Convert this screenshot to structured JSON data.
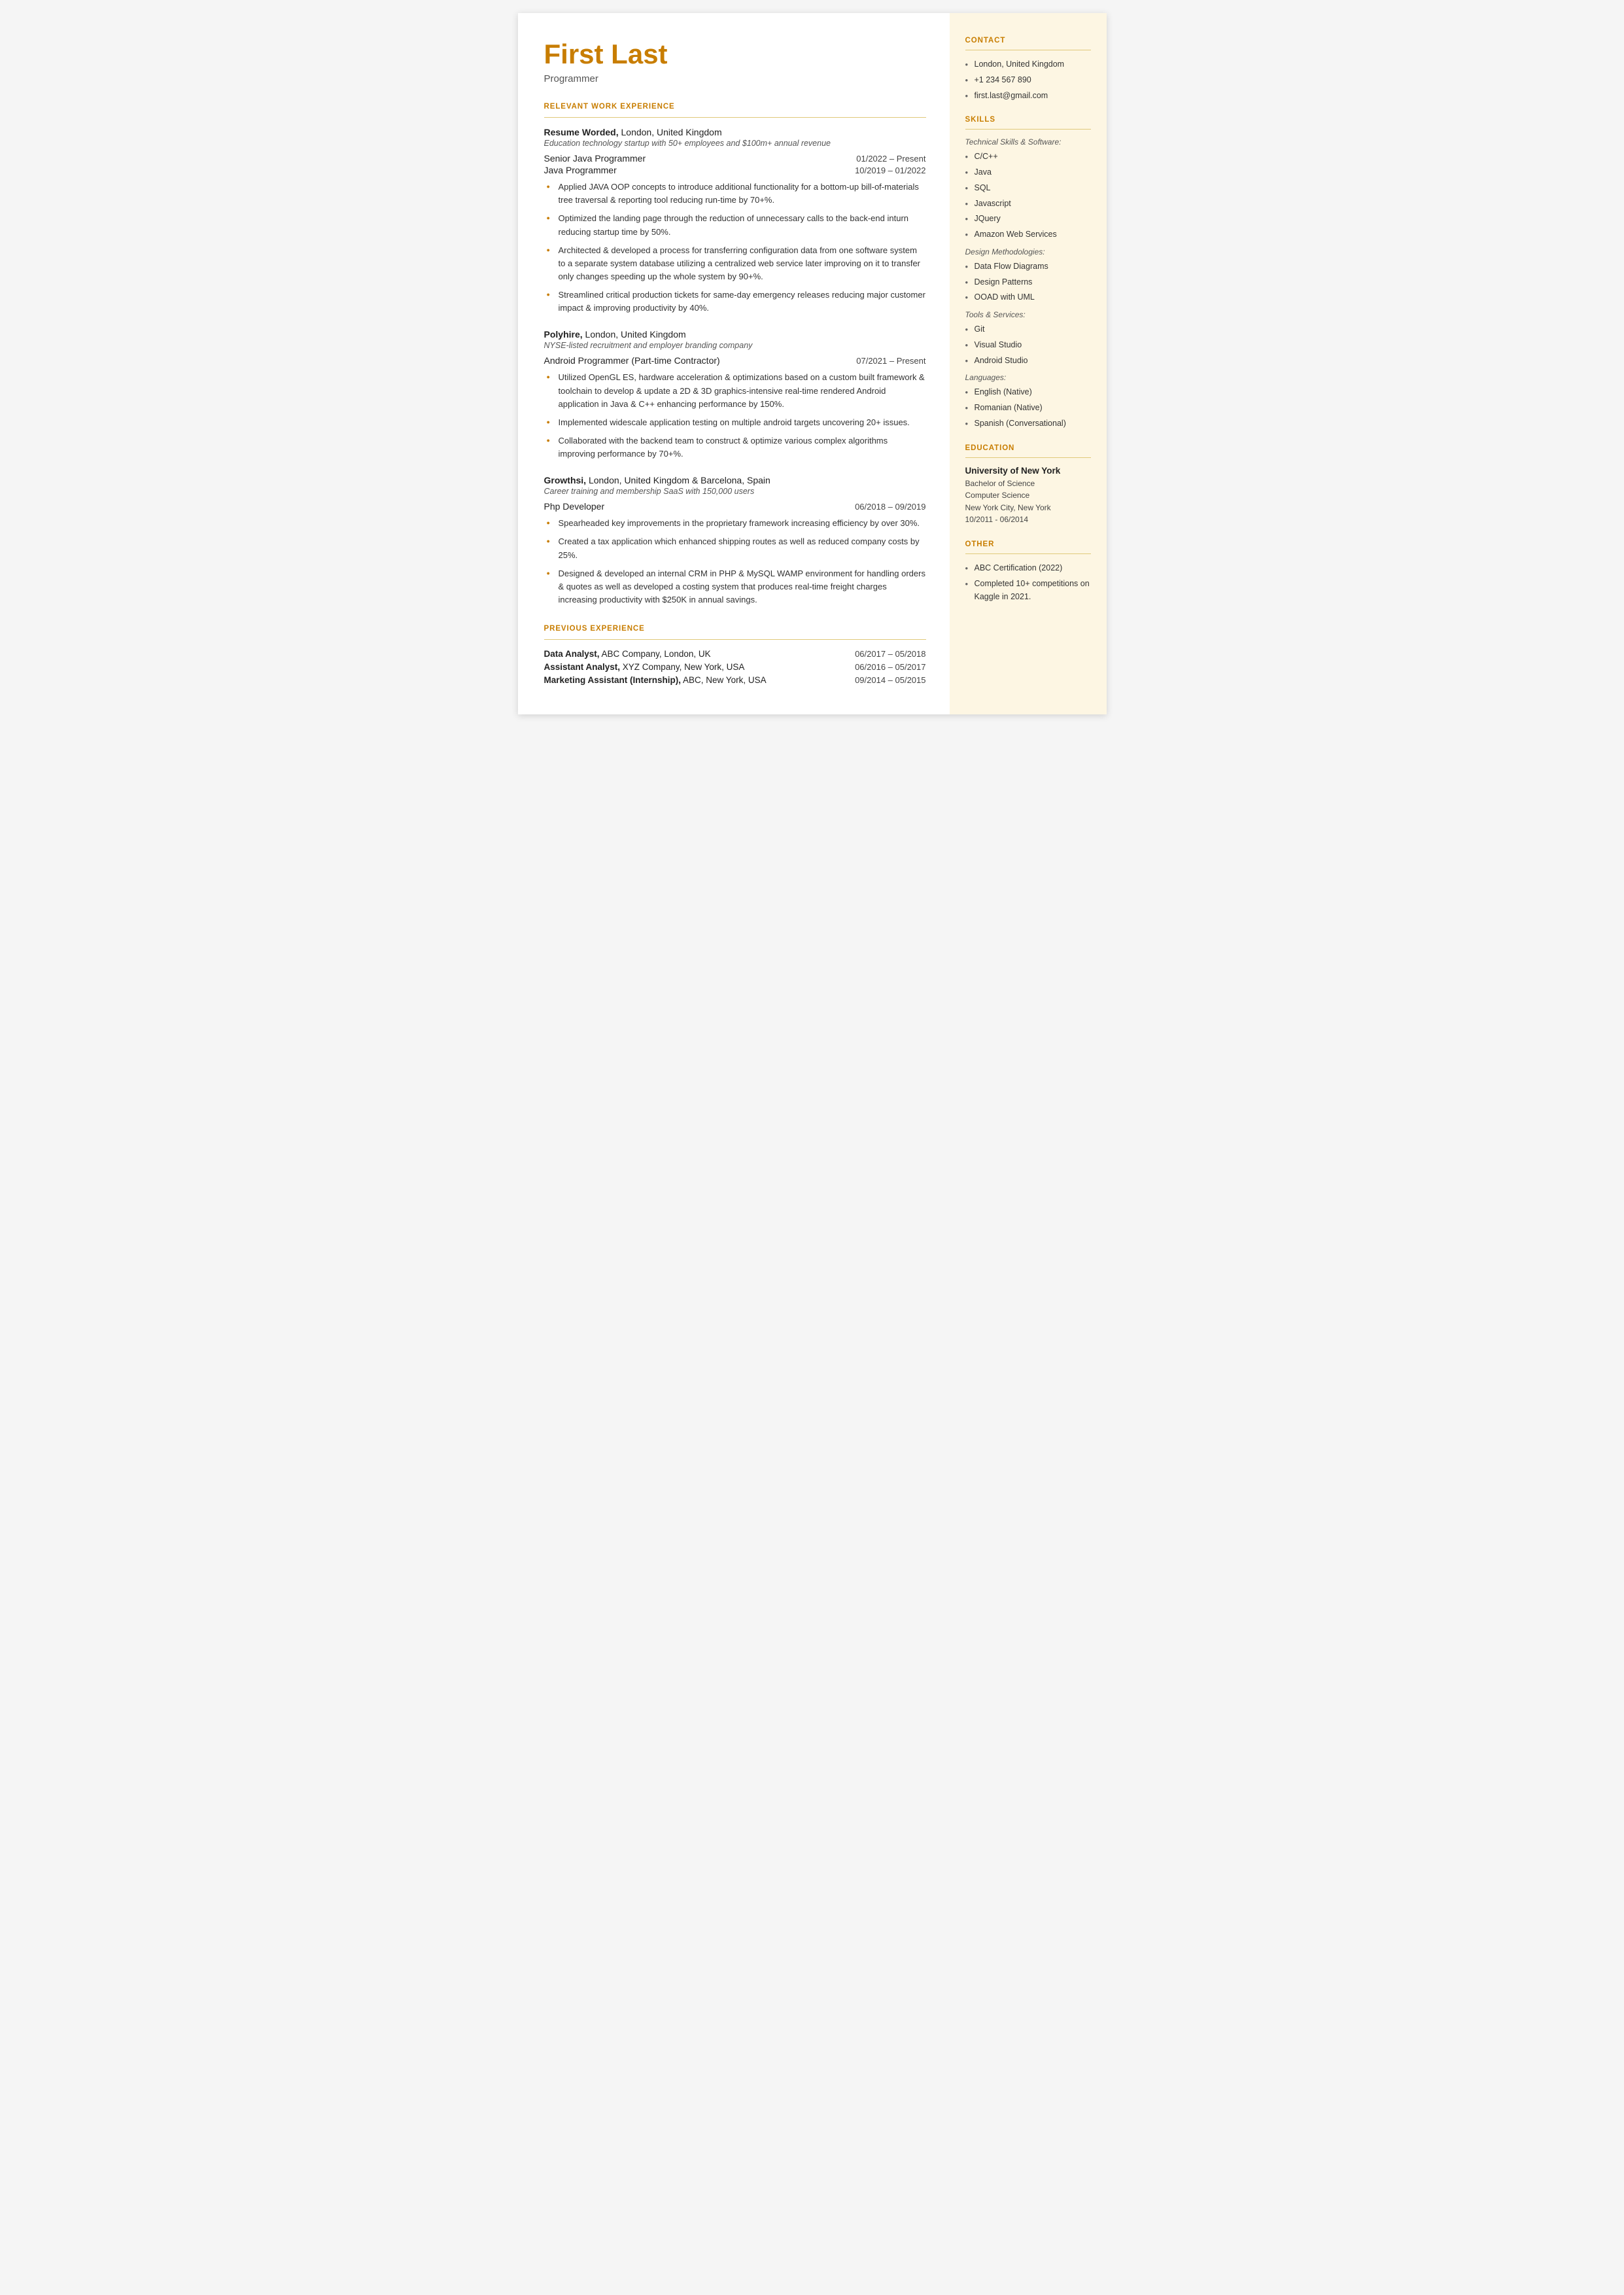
{
  "left": {
    "name": "First Last",
    "title": "Programmer",
    "sections": {
      "relevant_work": {
        "label": "RELEVANT WORK EXPERIENCE",
        "companies": [
          {
            "name": "Resume Worded,",
            "name_suffix": " London, United Kingdom",
            "desc": "Education technology startup with 50+ employees and $100m+ annual revenue",
            "roles": [
              {
                "title": "Senior Java Programmer",
                "date": "01/2022 – Present"
              },
              {
                "title": "Java Programmer",
                "date": "10/2019 – 01/2022"
              }
            ],
            "bullets": [
              "Applied JAVA OOP concepts to introduce additional functionality for a bottom-up bill-of-materials tree traversal & reporting tool reducing run-time by 70+%.",
              "Optimized the landing page through the reduction of unnecessary calls to the back-end inturn reducing startup time by 50%.",
              "Architected & developed a process for transferring configuration data from one software system to a separate system database utilizing a centralized web service later improving on it to transfer only changes speeding up the whole system by 90+%.",
              "Streamlined critical production tickets for same-day emergency releases reducing major customer impact & improving productivity by 40%."
            ]
          },
          {
            "name": "Polyhire,",
            "name_suffix": " London, United Kingdom",
            "desc": "NYSE-listed recruitment and employer branding company",
            "roles": [
              {
                "title": "Android Programmer (Part-time Contractor)",
                "date": "07/2021 – Present"
              }
            ],
            "bullets": [
              "Utilized OpenGL ES, hardware acceleration & optimizations based on a custom built framework & toolchain to develop & update a 2D & 3D graphics-intensive real-time rendered Android application in Java & C++ enhancing performance by 150%.",
              "Implemented widescale application testing on multiple android targets uncovering 20+ issues.",
              "Collaborated with the backend team to construct & optimize various complex algorithms improving performance by 70+%."
            ]
          },
          {
            "name": "Growthsi,",
            "name_suffix": " London, United Kingdom & Barcelona, Spain",
            "desc": "Career training and membership SaaS with 150,000 users",
            "roles": [
              {
                "title": "Php Developer",
                "date": "06/2018 – 09/2019"
              }
            ],
            "bullets": [
              "Spearheaded key improvements in the proprietary framework increasing efficiency by over 30%.",
              "Created a tax application which enhanced shipping routes as well as reduced company costs by 25%.",
              "Designed & developed an internal CRM in PHP & MySQL WAMP environment for handling orders & quotes as well as developed a costing system that produces real-time freight charges increasing productivity with $250K in annual savings."
            ]
          }
        ]
      },
      "previous_work": {
        "label": "PREVIOUS EXPERIENCE",
        "items": [
          {
            "title": "Data Analyst,",
            "company": " ABC Company, London, UK",
            "date": "06/2017 – 05/2018"
          },
          {
            "title": "Assistant Analyst,",
            "company": " XYZ Company, New York, USA",
            "date": "06/2016 – 05/2017"
          },
          {
            "title": "Marketing Assistant (Internship),",
            "company": " ABC, New York, USA",
            "date": "09/2014 – 05/2015"
          }
        ]
      }
    }
  },
  "right": {
    "contact": {
      "label": "CONTACT",
      "items": [
        "London, United Kingdom",
        "+1 234 567 890",
        "first.last@gmail.com"
      ]
    },
    "skills": {
      "label": "SKILLS",
      "subcategories": [
        {
          "name": "Technical Skills & Software:",
          "items": [
            "C/C++",
            "Java",
            "SQL",
            "Javascript",
            "JQuery",
            "Amazon Web Services"
          ]
        },
        {
          "name": "Design Methodologies:",
          "items": [
            "Data Flow Diagrams",
            "Design Patterns",
            "OOAD with UML"
          ]
        },
        {
          "name": "Tools & Services:",
          "items": [
            "Git",
            "Visual Studio",
            "Android Studio"
          ]
        },
        {
          "name": "Languages:",
          "items": [
            "English (Native)",
            "Romanian (Native)",
            "Spanish (Conversational)"
          ]
        }
      ]
    },
    "education": {
      "label": "EDUCATION",
      "school": "University of New York",
      "degree": "Bachelor of Science",
      "field": "Computer Science",
      "location": "New York City, New York",
      "dates": "10/2011 - 06/2014"
    },
    "other": {
      "label": "OTHER",
      "items": [
        "ABC Certification (2022)",
        "Completed 10+ competitions on Kaggle in 2021."
      ]
    }
  }
}
